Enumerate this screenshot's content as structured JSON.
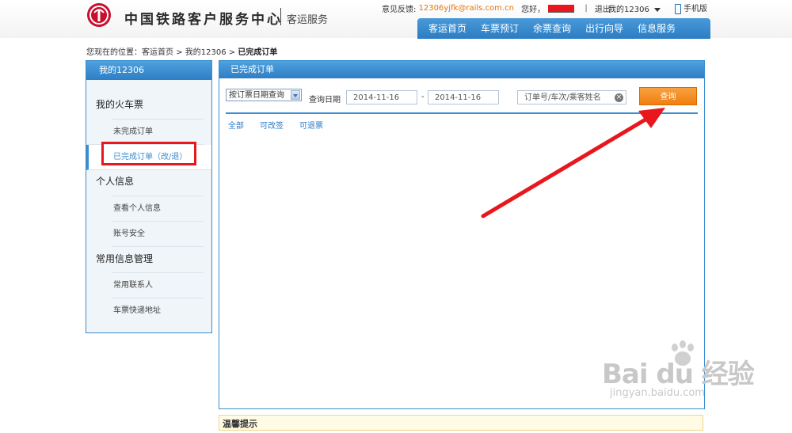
{
  "header": {
    "logo_text": "中国铁路客户服务中心",
    "logo_sub": "客运服务",
    "feedback_label": "意见反馈:",
    "feedback_email": "12306yjfk@rails.com.cn",
    "greeting": "您好，",
    "logout": "退出",
    "my12306": "我的12306",
    "mobile": "手机版"
  },
  "nav": {
    "items": [
      "客运首页",
      "车票预订",
      "余票查询",
      "出行向导",
      "信息服务"
    ]
  },
  "breadcrumb": {
    "prefix": "您现在的位置：",
    "home": "客运首页",
    "sep": ">",
    "my12306": "我的12306",
    "current": "已完成订单"
  },
  "sidebar": {
    "title": "我的12306",
    "groups": [
      {
        "label": "我的火车票",
        "items": [
          "未完成订单",
          "已完成订单（改/退）"
        ]
      },
      {
        "label": "个人信息",
        "items": [
          "查看个人信息",
          "账号安全"
        ]
      },
      {
        "label": "常用信息管理",
        "items": [
          "常用联系人",
          "车票快递地址"
        ]
      }
    ]
  },
  "main": {
    "title": "已完成订单",
    "query_type": "按订票日期查询",
    "date_label": "查询日期",
    "date_from": "2014-11-16",
    "date_sep": "-",
    "date_to": "2014-11-16",
    "search_placeholder": "订单号/车次/乘客姓名",
    "query_button": "查询",
    "tabs": [
      "全部",
      "可改签",
      "可退票"
    ]
  },
  "notice": {
    "title": "温馨提示"
  },
  "watermark": {
    "main": "Bai du 经验",
    "sub": "jingyan.baidu.com"
  },
  "colors": {
    "brand_red": "#c8102e",
    "nav_blue": "#2b7cc4",
    "query_orange": "#f07f10",
    "annotation_red": "#e8171e"
  }
}
